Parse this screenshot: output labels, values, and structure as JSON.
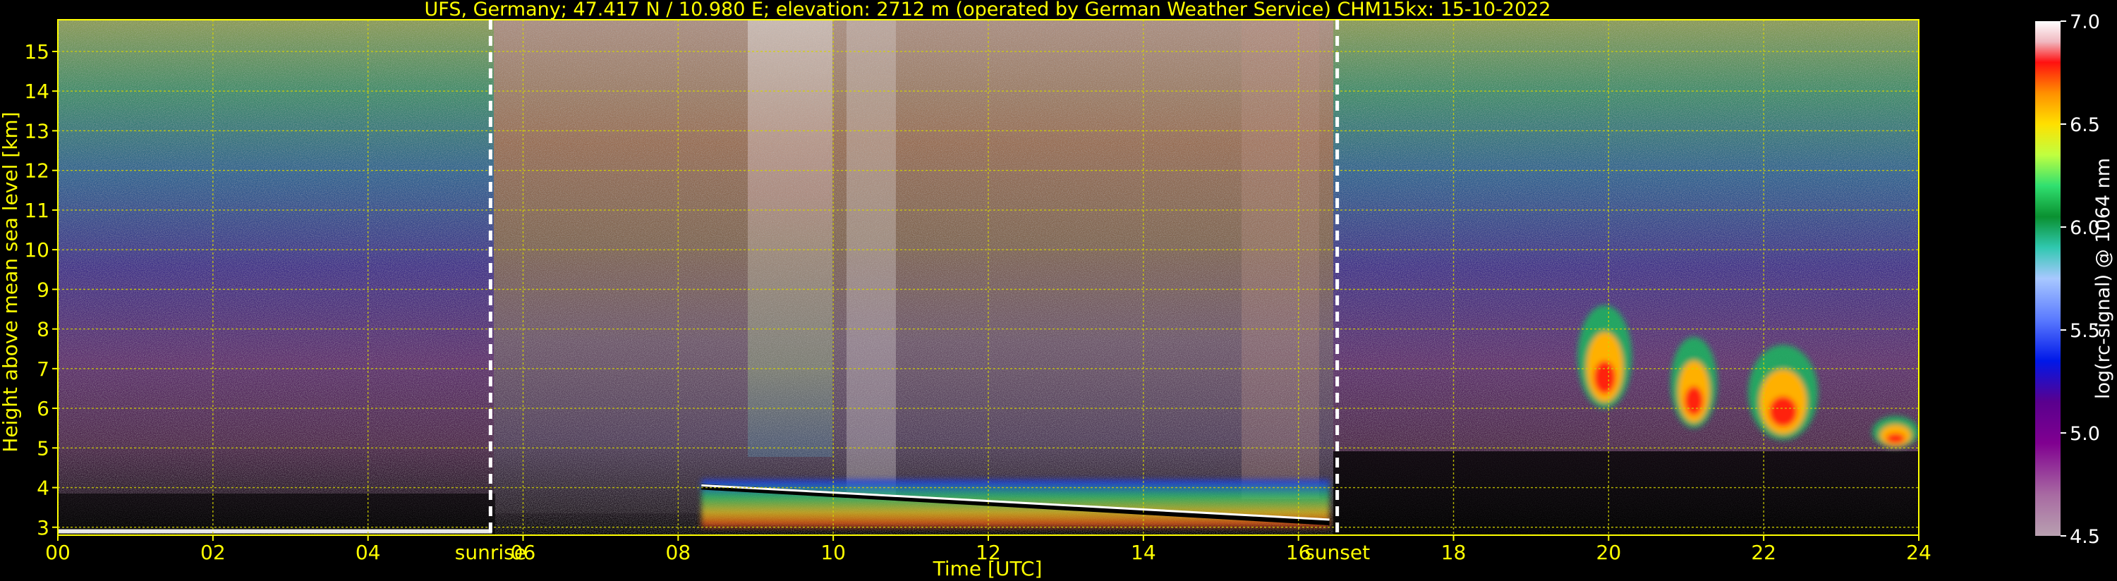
{
  "chart_data": {
    "type": "heatmap",
    "title": "UFS, Germany; 47.417 N / 10.980 E; elevation: 2712 m  (operated by German Weather Service)    CHM15kx: 15-10-2022",
    "xlabel": "Time [UTC]",
    "ylabel": "Height above mean sea level [km]",
    "xlim": [
      0,
      24
    ],
    "ylim": [
      2.8,
      15.8
    ],
    "x_ticks": [
      "00",
      "02",
      "04",
      "06",
      "08",
      "10",
      "12",
      "14",
      "16",
      "18",
      "20",
      "22",
      "24"
    ],
    "y_ticks": [
      "3",
      "4",
      "5",
      "6",
      "7",
      "8",
      "9",
      "10",
      "11",
      "12",
      "13",
      "14",
      "15"
    ],
    "grid": true,
    "annotations": [
      {
        "label": "sunrise",
        "x": 5.58
      },
      {
        "label": "sunset",
        "x": 16.5
      }
    ],
    "colorbar": {
      "label": "log(rc-signal) @ 1064 nm",
      "min": 4.5,
      "max": 7.0,
      "ticks": [
        "4.5",
        "5.0",
        "5.5",
        "6.0",
        "6.5",
        "7.0"
      ]
    },
    "features": [
      {
        "name": "surface layer",
        "x": [
          0,
          5.6
        ],
        "y": [
          2.85,
          2.95
        ]
      },
      {
        "name": "boundary layer",
        "x": [
          8.3,
          16.4
        ],
        "y": [
          3.0,
          4.2
        ]
      },
      {
        "name": "cloud",
        "x": [
          19.6,
          20.3
        ],
        "y": [
          6.0,
          8.6
        ]
      },
      {
        "name": "cloud",
        "x": [
          20.8,
          21.4
        ],
        "y": [
          5.5,
          7.8
        ]
      },
      {
        "name": "cloud",
        "x": [
          21.8,
          22.7
        ],
        "y": [
          5.2,
          7.6
        ]
      },
      {
        "name": "cloud",
        "x": [
          23.4,
          24.0
        ],
        "y": [
          5.0,
          5.8
        ]
      }
    ]
  },
  "colors": {
    "axis": "#ffff00",
    "text": "#ffff00",
    "grid": "#d4d400",
    "background": "#000000",
    "marker_lines": "#ffffff",
    "colorbar_text": "#ffffff"
  }
}
